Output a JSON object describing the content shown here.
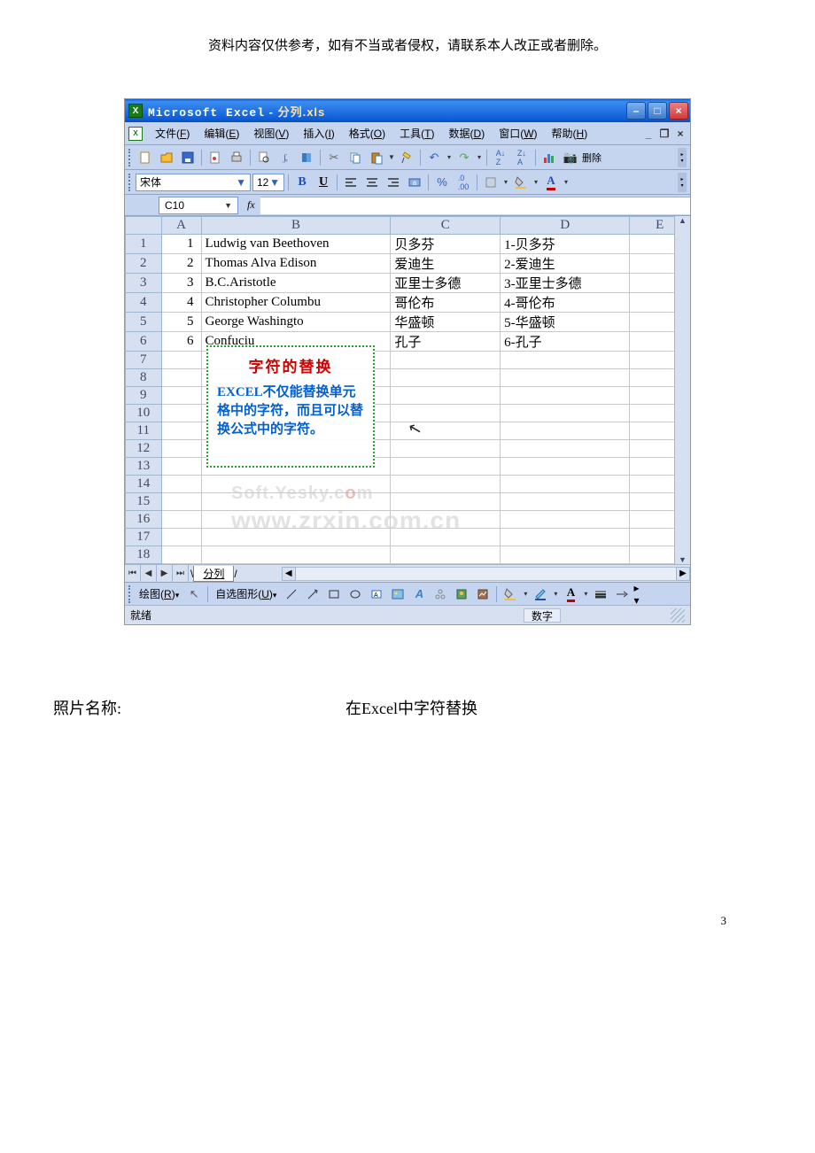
{
  "page": {
    "disclaimer": "资料内容仅供参考，如有不当或者侵权，请联系本人改正或者删除。",
    "caption_label": "照片名称:",
    "caption_value": "在Excel中字符替换",
    "page_number": "3"
  },
  "titlebar": {
    "app": "Microsoft Excel",
    "sep": " - ",
    "file": "分列.xls"
  },
  "menus": {
    "file": {
      "label": "文件",
      "hotkey": "F"
    },
    "edit": {
      "label": "编辑",
      "hotkey": "E"
    },
    "view": {
      "label": "视图",
      "hotkey": "V"
    },
    "insert": {
      "label": "插入",
      "hotkey": "I"
    },
    "format": {
      "label": "格式",
      "hotkey": "O"
    },
    "tools": {
      "label": "工具",
      "hotkey": "T"
    },
    "data": {
      "label": "数据",
      "hotkey": "D"
    },
    "window": {
      "label": "窗口",
      "hotkey": "W"
    },
    "help": {
      "label": "帮助",
      "hotkey": "H"
    }
  },
  "toolbar": {
    "delete_label": "删除"
  },
  "formatbar": {
    "font": "宋体",
    "size": "12"
  },
  "formulabar": {
    "cell_ref": "C10",
    "fx": "fx"
  },
  "columns": [
    "A",
    "B",
    "C",
    "D",
    "E"
  ],
  "rows": [
    {
      "n": "1",
      "a": "1",
      "b": "Ludwig van Beethoven",
      "c": "贝多芬",
      "d": "1-贝多芬"
    },
    {
      "n": "2",
      "a": "2",
      "b": "Thomas Alva Edison",
      "c": "爱迪生",
      "d": "2-爱迪生"
    },
    {
      "n": "3",
      "a": "3",
      "b": "B.C.Aristotle",
      "c": "亚里士多德",
      "d": "3-亚里士多德"
    },
    {
      "n": "4",
      "a": "4",
      "b": "Christopher Columbu",
      "c": "哥伦布",
      "d": "4-哥伦布"
    },
    {
      "n": "5",
      "a": "5",
      "b": "George Washingto",
      "c": "华盛顿",
      "d": "5-华盛顿"
    },
    {
      "n": "6",
      "a": "6",
      "b": "Confuciu",
      "c": "孔子",
      "d": "6-孔子"
    },
    {
      "n": "7",
      "a": "",
      "b": "",
      "c": "",
      "d": ""
    },
    {
      "n": "8",
      "a": "",
      "b": "",
      "c": "",
      "d": ""
    },
    {
      "n": "9",
      "a": "",
      "b": "",
      "c": "",
      "d": ""
    },
    {
      "n": "10",
      "a": "",
      "b": "",
      "c": "",
      "d": ""
    },
    {
      "n": "11",
      "a": "",
      "b": "",
      "c": "",
      "d": ""
    },
    {
      "n": "12",
      "a": "",
      "b": "",
      "c": "",
      "d": ""
    },
    {
      "n": "13",
      "a": "",
      "b": "",
      "c": "",
      "d": ""
    },
    {
      "n": "14",
      "a": "",
      "b": "",
      "c": "",
      "d": ""
    },
    {
      "n": "15",
      "a": "",
      "b": "",
      "c": "",
      "d": ""
    },
    {
      "n": "16",
      "a": "",
      "b": "",
      "c": "",
      "d": ""
    },
    {
      "n": "17",
      "a": "",
      "b": "",
      "c": "",
      "d": ""
    },
    {
      "n": "18",
      "a": "",
      "b": "",
      "c": "",
      "d": ""
    }
  ],
  "callout": {
    "title": "字符的替换",
    "body": "EXCEL不仅能替换单元格中的字符，而且可以替换公式中的字符。"
  },
  "watermark": {
    "soft": "Soft.Yesky.c",
    "red": "o",
    "soft2": "m",
    "main": "www.zrxin.com.cn"
  },
  "sheet": {
    "tab": "分列"
  },
  "drawbar": {
    "draw": {
      "label": "绘图",
      "hotkey": "R"
    },
    "autoshape": {
      "label": "自选图形",
      "hotkey": "U"
    }
  },
  "status": {
    "ready": "就绪",
    "indicator": "数字"
  }
}
